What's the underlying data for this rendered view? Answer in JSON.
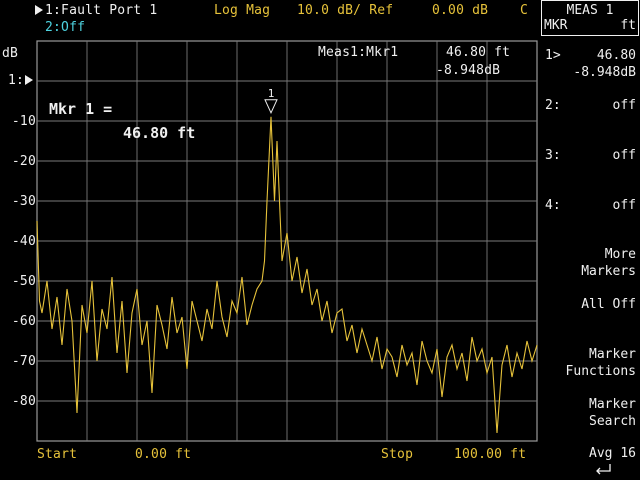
{
  "header": {
    "trace1": "1:Fault Port 1",
    "format": "Log Mag",
    "scale": "10.0 dB/ Ref",
    "ref_value": "0.00 dB",
    "flag": "C",
    "trace2": "2:Off"
  },
  "yaxis": {
    "unit": "dB",
    "ref_label": "1:",
    "ticks": [
      "-10",
      "-20",
      "-30",
      "-40",
      "-50",
      "-60",
      "-70",
      "-80"
    ]
  },
  "marker_readout": {
    "label": "Meas1:Mkr1",
    "value": "46.80 ft",
    "level": "-8.948dB"
  },
  "marker_big": {
    "line1": "Mkr 1 =",
    "line2": "46.80 ft"
  },
  "marker_flag": "1",
  "footer": {
    "start_label": "Start",
    "start_value": "0.00 ft",
    "stop_label": "Stop",
    "stop_value": "100.00 ft"
  },
  "softkeys": {
    "title": "MEAS 1",
    "sub_left": "MKR",
    "sub_right": "ft",
    "m1_label": "1>",
    "m1_value": "46.80",
    "m1_level": "-8.948dB",
    "m2_label": "2:",
    "m2_value": "off",
    "m3_label": "3:",
    "m3_value": "off",
    "m4_label": "4:",
    "m4_value": "off",
    "more_1": "More",
    "more_2": "Markers",
    "alloff": "All Off",
    "mf_1": "Marker",
    "mf_2": "Functions",
    "ms_1": "Marker",
    "ms_2": "Search",
    "avg": "Avg 16"
  },
  "chart_data": {
    "type": "line",
    "xlim": [
      0,
      100
    ],
    "ylim": [
      -90,
      10
    ],
    "x_unit": "ft",
    "y_unit": "dB",
    "grid": true,
    "marker": {
      "name": "1",
      "x": 46.8,
      "y": -8.948
    },
    "series": [
      {
        "color": "#e6c23a",
        "x": [
          0,
          0.5,
          1,
          2,
          3,
          4,
          5,
          6,
          7,
          8,
          9,
          10,
          11,
          12,
          13,
          14,
          15,
          16,
          17,
          18,
          19,
          20,
          21,
          22,
          23,
          24,
          25,
          26,
          27,
          28,
          29,
          30,
          31,
          32,
          33,
          34,
          35,
          36,
          37,
          38,
          39,
          40,
          41,
          42,
          43,
          44,
          45,
          45.5,
          46,
          46.8,
          47.5,
          48,
          49,
          50,
          51,
          52,
          53,
          54,
          55,
          56,
          57,
          58,
          59,
          60,
          61,
          62,
          63,
          64,
          65,
          66,
          67,
          68,
          69,
          70,
          71,
          72,
          73,
          74,
          75,
          76,
          77,
          78,
          79,
          80,
          81,
          82,
          83,
          84,
          85,
          86,
          87,
          88,
          89,
          90,
          91,
          92,
          93,
          94,
          95,
          96,
          97,
          98,
          99,
          100
        ],
        "y": [
          -35,
          -55,
          -58,
          -50,
          -62,
          -54,
          -66,
          -52,
          -60,
          -83,
          -56,
          -63,
          -50,
          -70,
          -57,
          -62,
          -49,
          -68,
          -55,
          -73,
          -58,
          -52,
          -66,
          -60,
          -78,
          -56,
          -61,
          -67,
          -54,
          -63,
          -59,
          -72,
          -55,
          -60,
          -65,
          -57,
          -62,
          -50,
          -59,
          -64,
          -55,
          -58,
          -49,
          -61,
          -56,
          -52,
          -50,
          -45,
          -30,
          -8.948,
          -30,
          -15,
          -45,
          -38,
          -50,
          -44,
          -53,
          -47,
          -56,
          -52,
          -60,
          -55,
          -63,
          -58,
          -57,
          -65,
          -61,
          -68,
          -62,
          -66,
          -70,
          -64,
          -72,
          -67,
          -69,
          -74,
          -66,
          -71,
          -68,
          -76,
          -65,
          -70,
          -73,
          -67,
          -79,
          -69,
          -66,
          -72,
          -68,
          -75,
          -64,
          -70,
          -67,
          -73,
          -69,
          -88,
          -71,
          -66,
          -74,
          -68,
          -72,
          -65,
          -70,
          -66
        ]
      }
    ]
  }
}
